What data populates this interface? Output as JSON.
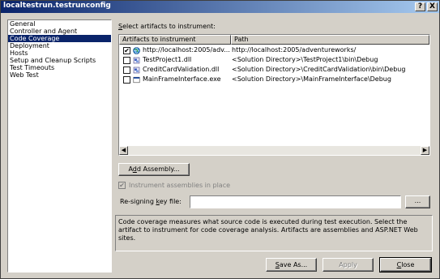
{
  "window": {
    "title": "localtestrun.testrunconfig"
  },
  "titlebar": {
    "help": "?",
    "close": "X"
  },
  "sidebar": {
    "items": [
      {
        "label": "General",
        "selected": false
      },
      {
        "label": "Controller and Agent",
        "selected": false
      },
      {
        "label": "Code Coverage",
        "selected": true
      },
      {
        "label": "Deployment",
        "selected": false
      },
      {
        "label": "Hosts",
        "selected": false
      },
      {
        "label": "Setup and Cleanup Scripts",
        "selected": false
      },
      {
        "label": "Test Timeouts",
        "selected": false
      },
      {
        "label": "Web Test",
        "selected": false
      }
    ]
  },
  "main": {
    "select_label_pre": "",
    "select_label_u": "S",
    "select_label_post": "elect artifacts to instrument:",
    "columns": [
      "Artifacts to instrument",
      "Path"
    ],
    "rows": [
      {
        "checked": true,
        "icon": "web-icon",
        "name": "http://localhost:2005/adv...",
        "path": "http://localhost:2005/adventureworks/"
      },
      {
        "checked": false,
        "icon": "dll-icon",
        "name": "TestProject1.dll",
        "path": "<Solution Directory>\\TestProject1\\bin\\Debug"
      },
      {
        "checked": false,
        "icon": "dll-icon",
        "name": "CreditCardValidation.dll",
        "path": "<Solution Directory>\\CreditCardValidation\\bin\\Debug"
      },
      {
        "checked": false,
        "icon": "exe-icon",
        "name": "MainFrameInterface.exe",
        "path": "<Solution Directory>\\MainFrameInterface\\Debug"
      }
    ],
    "add_assembly_pre": "A",
    "add_assembly_u": "d",
    "add_assembly_post": "d Assembly...",
    "instrument_checkbox_label": "Instrument assemblies in place",
    "resign_label_pre": "Re-signing ",
    "resign_label_u": "k",
    "resign_label_post": "ey file:",
    "resign_value": "",
    "browse_label": "...",
    "description": "Code coverage measures what source code is executed during test execution. Select the artifact to instrument for code coverage analysis. Artifacts are assemblies and ASP.NET Web sites."
  },
  "footer": {
    "save_pre": "",
    "save_u": "S",
    "save_post": "ave As...",
    "apply_label": "Apply",
    "close_pre": "",
    "close_u": "C",
    "close_post": "lose"
  },
  "colors": {
    "selection": "#0a246a",
    "face": "#d4d0c8"
  }
}
